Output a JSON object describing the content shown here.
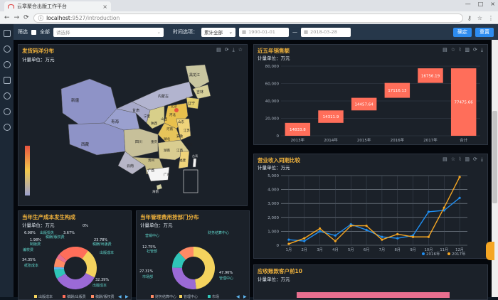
{
  "browser": {
    "tab_title": "云章聚合出版工作平台",
    "tab_close": "×",
    "url_host": "localhost",
    "url_path": ":9527/introduction",
    "window_controls": [
      "—",
      "□",
      "×"
    ]
  },
  "filter": {
    "label": "筛选",
    "all_label": "全部",
    "select_placeholder": "请选择",
    "time_label": "时间选项：",
    "time_value": "累计全部",
    "date_start": "1900-01-01",
    "date_sep": "—",
    "date_end": "2018-03-28",
    "confirm": "确定",
    "reset": "重置"
  },
  "panels": {
    "map": {
      "title": "发货码洋分布",
      "unit": "计量单位：万元",
      "provinces": [
        "新疆",
        "西藏",
        "青海",
        "甘肃",
        "内蒙古",
        "黑龙江",
        "吉林",
        "辽宁",
        "北京",
        "河北",
        "山西",
        "陕西",
        "宁夏",
        "河南",
        "山东",
        "江苏",
        "安徽",
        "湖北",
        "四川",
        "重庆",
        "湖南",
        "江西",
        "浙江",
        "贵州",
        "云南",
        "广西",
        "广东",
        "福建",
        "台湾",
        "海南"
      ]
    },
    "sales": {
      "title": "近五年销售额",
      "unit": "计量单位：万元"
    },
    "revenue": {
      "title": "营业收入同期比较",
      "unit": "计量单位：万元"
    },
    "cost": {
      "title": "当年生产成本发生构成",
      "unit": "计量单位：万元"
    },
    "mgmt": {
      "title": "当年管理费用按部门分布",
      "unit": "计量单位：万元"
    },
    "receivable": {
      "title": "应收账款客户前10",
      "unit": "计量单位：万元"
    }
  },
  "chart_data": [
    {
      "type": "bar",
      "id": "sales",
      "categories": [
        "2013年",
        "2014年",
        "2015年",
        "2016年",
        "2017年",
        "合计"
      ],
      "values": [
        14833.8,
        14311.9,
        14457.64,
        17116.13,
        16756.19,
        77475.66
      ],
      "ylim": [
        0,
        80000
      ],
      "yticks": [
        "0",
        "20,000",
        "40,000",
        "60,000",
        "80,000"
      ],
      "color": "#ff6e5a"
    },
    {
      "type": "line",
      "id": "revenue",
      "categories": [
        "1月",
        "2月",
        "3月",
        "4月",
        "5月",
        "6月",
        "7月",
        "8月",
        "9月",
        "10月",
        "11月",
        "12月"
      ],
      "series": [
        {
          "name": "2016年",
          "color": "#1f8ef1",
          "values": [
            400,
            300,
            1000,
            700,
            1500,
            1100,
            600,
            500,
            700,
            2400,
            2500,
            3400
          ]
        },
        {
          "name": "2017年",
          "color": "#f5a623",
          "values": [
            100,
            500,
            1200,
            300,
            1400,
            1400,
            400,
            800,
            600,
            600,
            2700,
            4900
          ]
        }
      ],
      "ylim": [
        0,
        5000
      ],
      "yticks": [
        "0",
        "1,000",
        "2,000",
        "3,000",
        "4,000",
        "5,000"
      ]
    },
    {
      "type": "pie",
      "id": "cost",
      "slices": [
        {
          "label": "出版成本",
          "percent": 32.39,
          "color": "#f4d35e"
        },
        {
          "label": "纸张成本",
          "percent": 34.35,
          "color": "#9b6ad6"
        },
        {
          "label": "制版费",
          "percent": 6.98,
          "color": "#2fc5b8"
        },
        {
          "label": "编校费",
          "percent": 1.98,
          "color": "#5fb6f0"
        },
        {
          "label": "稿酬/版权费",
          "percent": 6.98,
          "color": "#ff8a65"
        },
        {
          "label": "出版损失",
          "percent": 3.67,
          "color": "#e86f8f"
        },
        {
          "label": "稿酬/出版费",
          "percent": 23.78,
          "color": "#ff6e5a"
        },
        {
          "label": "其他",
          "percent": 0,
          "color": "#8bc34a"
        }
      ],
      "labels_shown": [
        "3.67%",
        "6.98%",
        "1.98%",
        "23.78%",
        "34.35%",
        "32.39%",
        "0%"
      ],
      "text_labels": [
        "出版损失",
        "稿酬/版权费",
        "制版费",
        "编校费",
        "纸张成本",
        "出版成本",
        "出版成本",
        "稿酬/出版费"
      ],
      "legend": [
        "出版成本",
        "稿酬/出版费",
        "稿酬/版权费"
      ]
    },
    {
      "type": "pie",
      "id": "mgmt",
      "slices": [
        {
          "label": "管理中心",
          "percent": 47.96,
          "color": "#f4d35e"
        },
        {
          "label": "市场部",
          "percent": 27.31,
          "color": "#9b6ad6"
        },
        {
          "label": "营销中心",
          "percent": 12.75,
          "color": "#2fc5b8"
        },
        {
          "label": "财务结算中心",
          "percent": 11.98,
          "color": "#ff8a65"
        }
      ],
      "labels_shown": [
        "47.96%",
        "27.31%",
        "12.75%"
      ],
      "text_labels": [
        "营销中心",
        "财务结算中心",
        "社管部",
        "管理中心",
        "市场部"
      ],
      "legend": [
        "财务结算中心",
        "管理中心",
        "市场"
      ]
    }
  ]
}
